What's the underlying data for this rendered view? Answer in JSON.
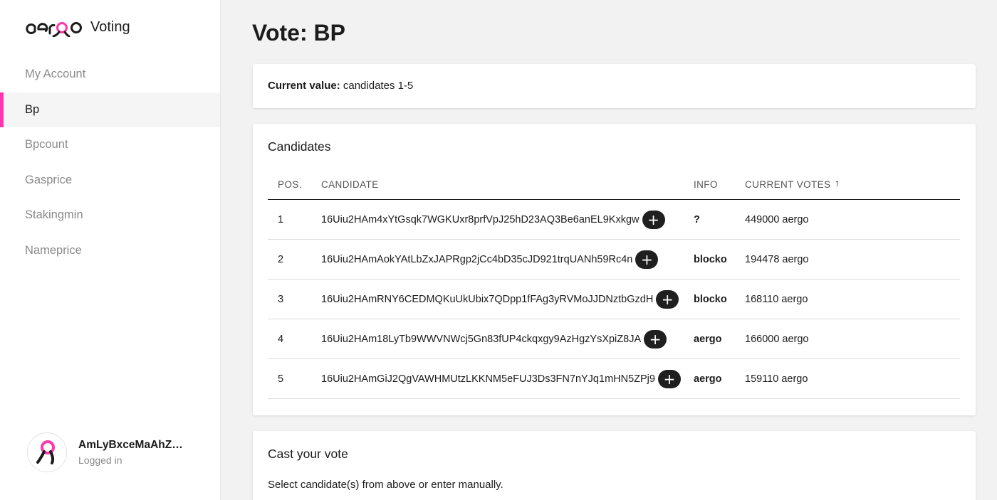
{
  "brand": {
    "name": "Voting"
  },
  "sidebar": {
    "items": [
      {
        "label": "My Account",
        "active": false
      },
      {
        "label": "Bp",
        "active": true
      },
      {
        "label": "Bpcount",
        "active": false
      },
      {
        "label": "Gasprice",
        "active": false
      },
      {
        "label": "Stakingmin",
        "active": false
      },
      {
        "label": "Nameprice",
        "active": false
      }
    ],
    "account": {
      "name": "AmLyBxceMaAhZFx...",
      "status": "Logged in"
    }
  },
  "page": {
    "title": "Vote: BP"
  },
  "current": {
    "label": "Current value:",
    "value": " candidates 1-5"
  },
  "candidates": {
    "title": "Candidates",
    "columns": {
      "pos": "POS.",
      "candidate": "CANDIDATE",
      "info": "INFO",
      "votes": "CURRENT VOTES",
      "sort_indicator": "↑"
    },
    "rows": [
      {
        "pos": "1",
        "candidate": "16Uiu2HAm4xYtGsqk7WGKUxr8prfVpJ25hD23AQ3Be6anEL9Kxkgw",
        "info": "?",
        "votes": "449000 aergo"
      },
      {
        "pos": "2",
        "candidate": "16Uiu2HAmAokYAtLbZxJAPRgp2jCc4bD35cJD921trqUANh59Rc4n",
        "info": "blocko",
        "votes": "194478 aergo"
      },
      {
        "pos": "3",
        "candidate": "16Uiu2HAmRNY6CEDMQKuUkUbix7QDpp1fFAg3yRVMoJJDNztbGzdH",
        "info": "blocko",
        "votes": "168110 aergo"
      },
      {
        "pos": "4",
        "candidate": "16Uiu2HAm18LyTb9WWVNWcj5Gn83fUP4ckqxgy9AzHgzYsXpiZ8JA",
        "info": "aergo",
        "votes": "166000 aergo"
      },
      {
        "pos": "5",
        "candidate": "16Uiu2HAmGiJ2QgVAWHMUtzLKKNM5eFUJ3Ds3FN7nYJq1mHN5ZPj9",
        "info": "aergo",
        "votes": "159110 aergo"
      }
    ],
    "add_label": "+"
  },
  "vote": {
    "title": "Cast your vote",
    "hint": "Select candidate(s) from above or enter manually."
  },
  "colors": {
    "accent": "#ff36ad",
    "dark": "#1f1f1f"
  }
}
